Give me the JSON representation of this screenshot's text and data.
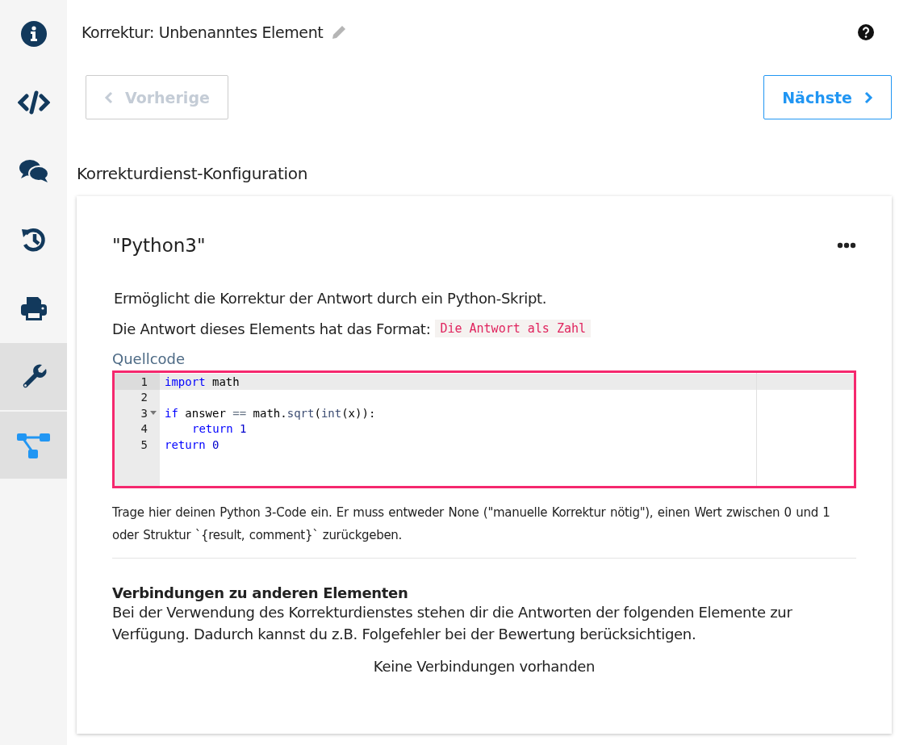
{
  "sidebar": {
    "items": [
      {
        "kind": "info",
        "selected": false,
        "hovered": false
      },
      {
        "kind": "code",
        "selected": false,
        "hovered": false
      },
      {
        "kind": "comments",
        "selected": false,
        "hovered": false
      },
      {
        "kind": "history",
        "selected": false,
        "hovered": false
      },
      {
        "kind": "print",
        "selected": false,
        "hovered": false
      },
      {
        "kind": "wrench",
        "selected": false,
        "hovered": true
      },
      {
        "kind": "tree",
        "selected": true,
        "hovered": false
      }
    ]
  },
  "header": {
    "title": "Korrektur: Unbenanntes Element"
  },
  "navigation": {
    "previous": {
      "label": "Vorherige",
      "disabled": true
    },
    "next": {
      "label": "Nächste",
      "disabled": false
    }
  },
  "section_title": "Korrekturdienst-Konfiguration",
  "card": {
    "title": "\"Python3\"",
    "description": "Ermöglicht die Korrektur der Antwort durch ein Python-Skript.",
    "format_label": "Die Antwort dieses Elements hat das Format:",
    "format_value": "Die Antwort als Zahl",
    "editor": {
      "label": "Quellcode",
      "lines": [
        {
          "number": "1",
          "fold": false,
          "active": true,
          "indented": false,
          "tokens": [
            {
              "kind": "keyword",
              "text": "import"
            },
            {
              "kind": "plain",
              "text": " math"
            }
          ]
        },
        {
          "number": "2",
          "fold": false,
          "active": false
        },
        {
          "number": "3",
          "fold": true,
          "active": false,
          "indented": false,
          "tokens": [
            {
              "kind": "keyword",
              "text": "if"
            },
            {
              "kind": "plain",
              "text": " answer "
            },
            {
              "kind": "operator",
              "text": "=="
            },
            {
              "kind": "plain",
              "text": " math."
            },
            {
              "kind": "function",
              "text": "sqrt"
            },
            {
              "kind": "plain",
              "text": "("
            },
            {
              "kind": "function",
              "text": "int"
            },
            {
              "kind": "plain",
              "text": "(x)):"
            }
          ]
        },
        {
          "number": "4",
          "fold": false,
          "active": false,
          "indented": true,
          "tokens": [
            {
              "kind": "keyword",
              "text": "return"
            },
            {
              "kind": "number",
              "text": " 1"
            }
          ]
        },
        {
          "number": "5",
          "fold": false,
          "active": false,
          "indented": false,
          "tokens": [
            {
              "kind": "keyword",
              "text": "return"
            },
            {
              "kind": "number",
              "text": " 0"
            }
          ]
        }
      ],
      "help": "Trage hier deinen Python 3-Code ein. Er muss entweder None (\"manuelle Korrektur nötig\"), einen Wert zwischen 0 und 1 oder Struktur `{result, comment}` zurückgeben."
    },
    "connections": {
      "title": "Verbindungen zu anderen Elementen",
      "description": "Bei der Verwendung des Korrekturdienstes stehen dir die Antworten der folgenden Elemente zur Verfügung. Dadurch kannst du z.B. Folgefehler bei der Bewertung berücksichtigen.",
      "empty": "Keine Verbindungen vorhanden"
    }
  }
}
